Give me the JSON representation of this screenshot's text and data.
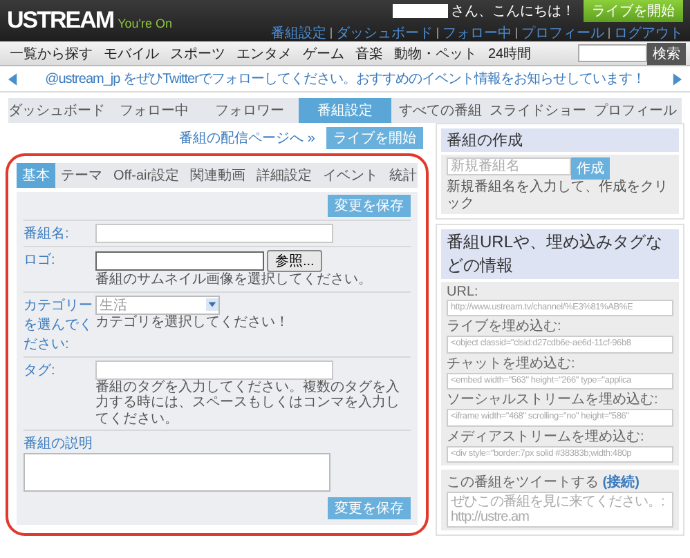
{
  "header": {
    "logo": "USTREAM",
    "tagline": "You're On",
    "greeting": "さん、こんにちは！",
    "links": [
      "番組設定",
      "ダッシュボード",
      "フォロー中",
      "プロフィール",
      "ログアウト"
    ],
    "start_button": "ライブを開始"
  },
  "nav": {
    "items": [
      "一覧から探す",
      "モバイル",
      "スポーツ",
      "エンタメ",
      "ゲーム",
      "音楽",
      "動物・ペット",
      "24時間"
    ],
    "search_button": "検索"
  },
  "ticker": {
    "text": "@ustream_jp をぜひTwitterでフォローしてください。おすすめのイベント情報をお知らせしています！"
  },
  "subnav": [
    {
      "label": "ダッシュボード",
      "selected": false
    },
    {
      "label": "フォロー中",
      "selected": false
    },
    {
      "label": "フォロワー",
      "selected": false
    },
    {
      "label": "番組設定",
      "selected": true
    },
    {
      "label": "すべての番組",
      "selected": false
    },
    {
      "label": "スライドショー",
      "selected": false
    },
    {
      "label": "プロフィール",
      "selected": false
    }
  ],
  "channel_link": "番組の配信ページへ »",
  "live_button": "ライブを開始",
  "panel": {
    "tabs": [
      {
        "label": "基本",
        "selected": true
      },
      {
        "label": "テーマ",
        "selected": false
      },
      {
        "label": "Off-air設定",
        "selected": false
      },
      {
        "label": "関連動画",
        "selected": false
      },
      {
        "label": "詳細設定",
        "selected": false
      },
      {
        "label": "イベント",
        "selected": false
      },
      {
        "label": "統計",
        "selected": false
      }
    ],
    "save_button": "変更を保存",
    "fields": [
      {
        "kind": "text",
        "label": "番組名:"
      },
      {
        "kind": "file",
        "label": "ロゴ:",
        "button": "参照...",
        "hint": "番組のサムネイル画像を選択してください。"
      },
      {
        "kind": "select",
        "label": "カテゴリーを選んでください:",
        "value": "生活",
        "hint": "カテゴリを選択してください！"
      },
      {
        "kind": "text",
        "label": "タグ:",
        "hint": "番組のタグを入力してください。複数のタグを入力する時には、スペースもしくはコンマを入力してください。"
      },
      {
        "kind": "textarea",
        "label": "番組の説明"
      }
    ],
    "bottom_save_button": "変更を保存"
  },
  "create_box": {
    "title": "番組の作成",
    "placeholder": "新規番組名",
    "button": "作成",
    "hint": "新規番組名を入力して、作成をクリック"
  },
  "embed_box": {
    "title": "番組URLや、埋め込みタグなどの情報",
    "fields": [
      {
        "label": "URL:",
        "value": "http://www.ustream.tv/channel/%E3%81%AB%E"
      },
      {
        "label": "ライブを埋め込む:",
        "value": "<object classid=\"clsid:d27cdb6e-ae6d-11cf-96b8"
      },
      {
        "label": "チャットを埋め込む:",
        "value": "<embed width=\"563\" height=\"266\" type=\"applica"
      },
      {
        "label": "ソーシャルストリームを埋め込む:",
        "value": "<iframe width=\"468\" scrolling=\"no\" height=\"586\""
      },
      {
        "label": "メディアストリームを埋め込む:",
        "value": "<div style=\"border:7px solid #38383b;width:480p"
      }
    ],
    "tweet": {
      "label": "この番組をツイートする",
      "link": "(接続)",
      "value": "ぜひこの番組を見に来てください。: http://ustre.am"
    }
  }
}
